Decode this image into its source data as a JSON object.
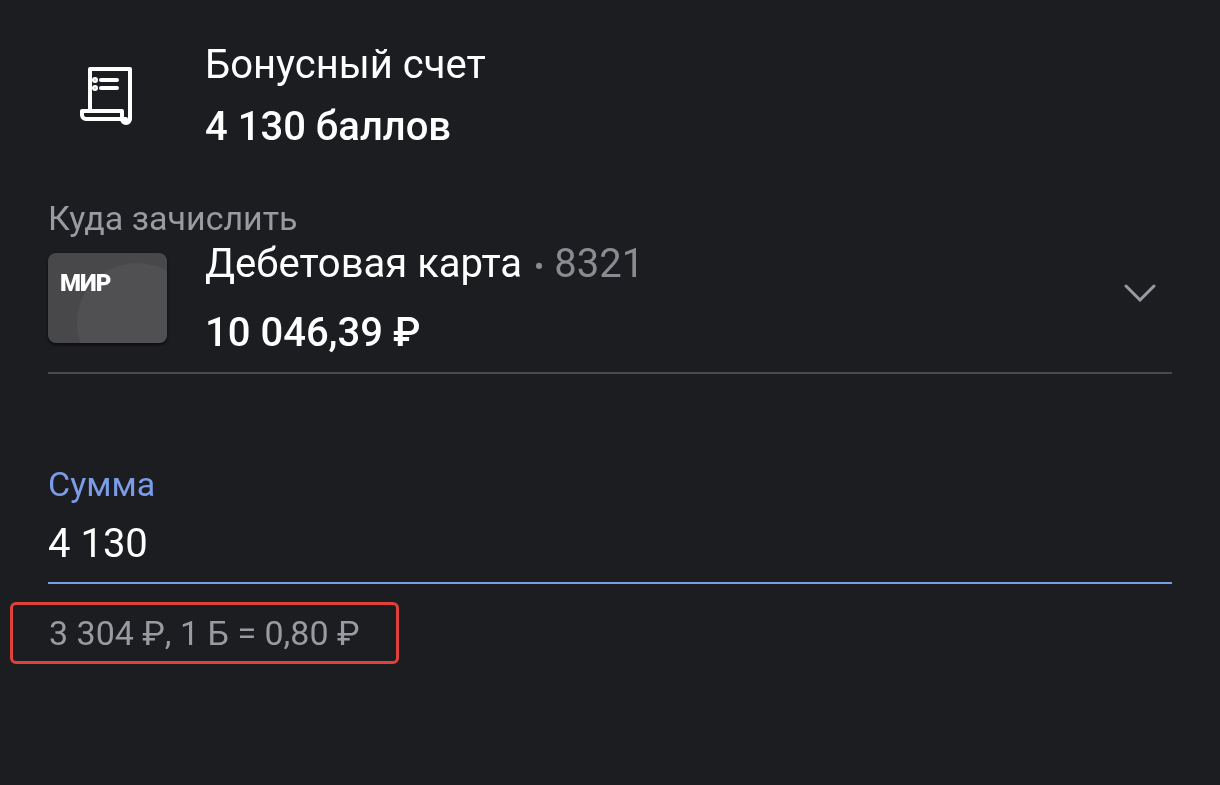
{
  "source": {
    "title": "Бонусный счет",
    "balance": "4 130 баллов"
  },
  "destination": {
    "label": "Куда зачислить",
    "card_logo": "МИР",
    "card_name": "Дебетовая карта",
    "separator": "•",
    "card_number": "8321",
    "balance": "10 046,39 ₽"
  },
  "amount": {
    "label": "Сумма",
    "value": "4 130",
    "focused": true,
    "hint": "3 304 ₽, 1 Б = 0,80 ₽",
    "hint_highlighted": true
  }
}
